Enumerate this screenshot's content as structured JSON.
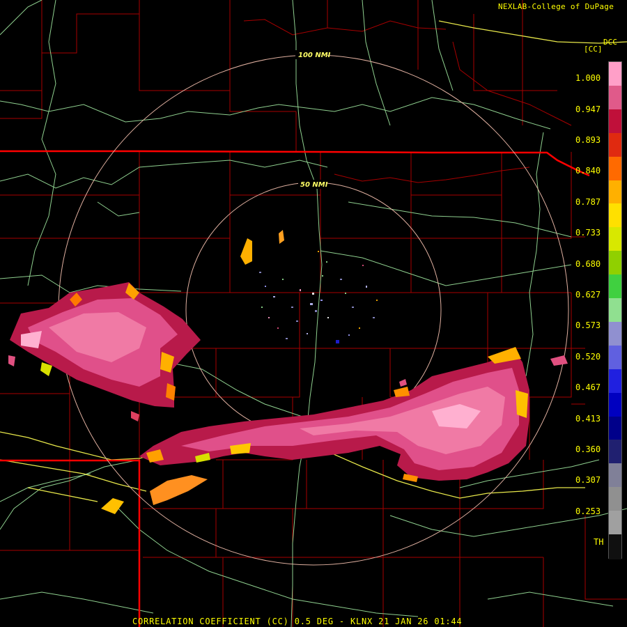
{
  "credit": "NEXLAB-College of DuPage",
  "legend": {
    "product": "DCC",
    "unit": "[CC]",
    "labels": [
      "1.000",
      "0.947",
      "0.893",
      "0.840",
      "0.787",
      "0.733",
      "0.680",
      "0.627",
      "0.573",
      "0.520",
      "0.467",
      "0.413",
      "0.360",
      "0.307",
      "0.253",
      "TH"
    ],
    "colors": [
      "#ff9fc8",
      "#e05a8a",
      "#c0103a",
      "#e02a10",
      "#ff6a00",
      "#ffb000",
      "#ffe000",
      "#d8e800",
      "#90d000",
      "#40d040",
      "#90e090",
      "#9090d0",
      "#6060e0",
      "#2020e0",
      "#0000c0",
      "#00008a",
      "#202070",
      "#808098",
      "#909090",
      "#a0a0a0",
      "#101010"
    ]
  },
  "range_rings": [
    "100 NMI",
    "50 NMI"
  ],
  "caption": "CORRELATION COEFFICIENT (CC) 0.5 DEG - KLNX 21 JAN 26 01:44",
  "colors": {
    "state_border": "#ff0000",
    "county_line": "#b00000",
    "roads": "#8fd08f",
    "highway": "#e8e84a",
    "ring": "#e0b0a0"
  }
}
